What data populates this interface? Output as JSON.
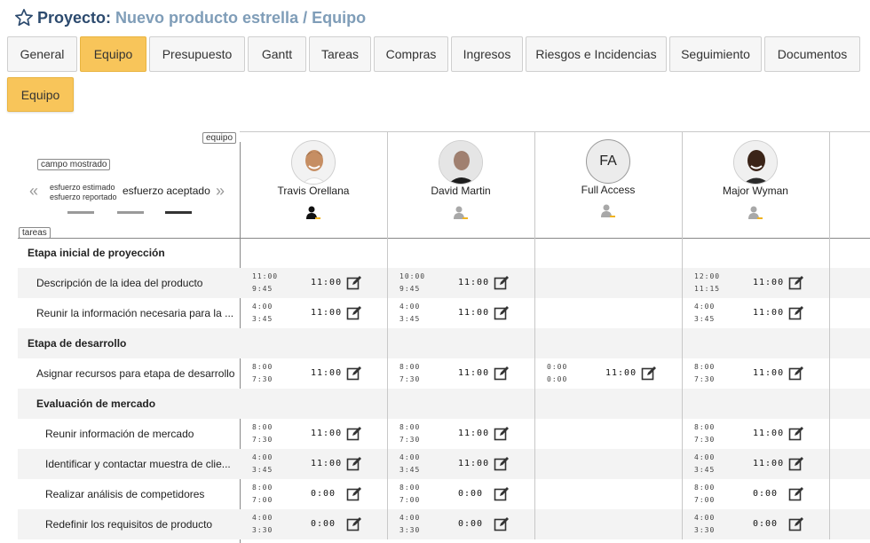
{
  "header": {
    "label": "Proyecto:",
    "path": "Nuevo producto estrella / Equipo"
  },
  "tabs": [
    {
      "label": "General",
      "active": false
    },
    {
      "label": "Equipo",
      "active": true
    },
    {
      "label": "Presupuesto",
      "active": false
    },
    {
      "label": "Gantt",
      "active": false
    },
    {
      "label": "Tareas",
      "active": false
    },
    {
      "label": "Compras",
      "active": false
    },
    {
      "label": "Ingresos",
      "active": false
    },
    {
      "label": "Riesgos e Incidencias",
      "active": false
    },
    {
      "label": "Seguimiento",
      "active": false
    },
    {
      "label": "Documentos",
      "active": false
    }
  ],
  "subtab": "Equipo",
  "labels": {
    "equipo": "equipo",
    "tareas": "tareas",
    "campo_mostrado": "campo mostrado",
    "estimado": "esfuerzo estimado",
    "reportado": "esfuerzo reportado",
    "aceptado": "esfuerzo aceptado",
    "prev": "«",
    "next": "»"
  },
  "bar_colors": {
    "estimado": "#9a9a9a",
    "reportado": "#9a9a9a",
    "aceptado": "#333333"
  },
  "members": [
    {
      "name": "Travis Orellana",
      "initials": ""
    },
    {
      "name": "David Martin",
      "initials": ""
    },
    {
      "name": "Full Access",
      "initials": "FA"
    },
    {
      "name": "Major Wyman",
      "initials": ""
    }
  ],
  "rows": [
    {
      "title": "Etapa inicial de proyección",
      "level": 0,
      "group": true,
      "cells": []
    },
    {
      "title": "Descripción de la idea del producto",
      "level": 1,
      "group": false,
      "cells": [
        {
          "e": "11:00",
          "r": "9:45",
          "a": "11:00"
        },
        {
          "e": "10:00",
          "r": "9:45",
          "a": "11:00"
        },
        null,
        {
          "e": "12:00",
          "r": "11:15",
          "a": "11:00"
        }
      ]
    },
    {
      "title": "Reunir la información necesaria para la ...",
      "level": 1,
      "group": false,
      "cells": [
        {
          "e": "4:00",
          "r": "3:45",
          "a": "11:00"
        },
        {
          "e": "4:00",
          "r": "3:45",
          "a": "11:00"
        },
        null,
        {
          "e": "4:00",
          "r": "3:45",
          "a": "11:00"
        }
      ]
    },
    {
      "title": "Etapa de desarrollo",
      "level": 0,
      "group": true,
      "cells": []
    },
    {
      "title": "Asignar recursos para etapa de desarrollo",
      "level": 1,
      "group": false,
      "cells": [
        {
          "e": "8:00",
          "r": "7:30",
          "a": "11:00"
        },
        {
          "e": "8:00",
          "r": "7:30",
          "a": "11:00"
        },
        {
          "e": "0:00",
          "r": "0:00",
          "a": "11:00"
        },
        {
          "e": "8:00",
          "r": "7:30",
          "a": "11:00"
        }
      ]
    },
    {
      "title": "Evaluación de mercado",
      "level": 1,
      "group": true,
      "cells": []
    },
    {
      "title": "Reunir información de mercado",
      "level": 2,
      "group": false,
      "cells": [
        {
          "e": "8:00",
          "r": "7:30",
          "a": "11:00"
        },
        {
          "e": "8:00",
          "r": "7:30",
          "a": "11:00"
        },
        null,
        {
          "e": "8:00",
          "r": "7:30",
          "a": "11:00"
        }
      ]
    },
    {
      "title": "Identificar y contactar muestra de clie...",
      "level": 2,
      "group": false,
      "cells": [
        {
          "e": "4:00",
          "r": "3:45",
          "a": "11:00"
        },
        {
          "e": "4:00",
          "r": "3:45",
          "a": "11:00"
        },
        null,
        {
          "e": "4:00",
          "r": "3:45",
          "a": "11:00"
        }
      ]
    },
    {
      "title": "Realizar análisis de competidores",
      "level": 2,
      "group": false,
      "cells": [
        {
          "e": "8:00",
          "r": "7:00",
          "a": "0:00"
        },
        {
          "e": "8:00",
          "r": "7:00",
          "a": "0:00"
        },
        null,
        {
          "e": "8:00",
          "r": "7:00",
          "a": "0:00"
        }
      ]
    },
    {
      "title": "Redefinir los requisitos de producto",
      "level": 2,
      "group": false,
      "cells": [
        {
          "e": "4:00",
          "r": "3:30",
          "a": "0:00"
        },
        {
          "e": "4:00",
          "r": "3:30",
          "a": "0:00"
        },
        null,
        {
          "e": "4:00",
          "r": "3:30",
          "a": "0:00"
        }
      ]
    }
  ]
}
